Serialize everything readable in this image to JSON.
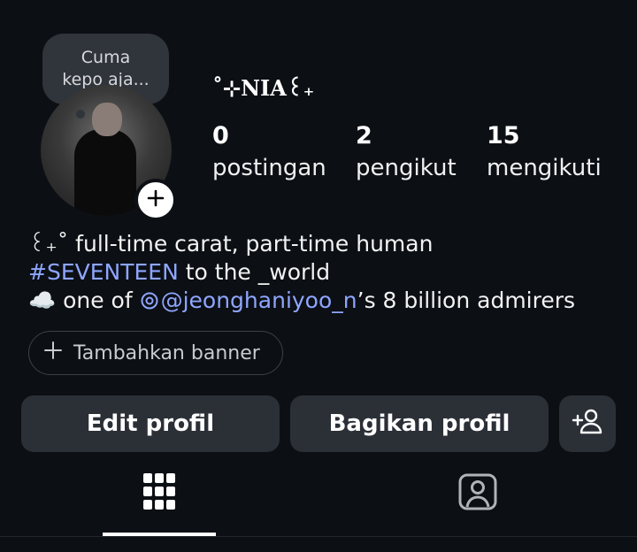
{
  "note": {
    "text_line1": "Cuma",
    "text_line2": "kepo aja..."
  },
  "profile": {
    "display_name": "˚⊹NIA꒰₊",
    "stats": [
      {
        "value": "0",
        "label": "postingan"
      },
      {
        "value": "2",
        "label": "pengikut"
      },
      {
        "value": "15",
        "label": "mengikuti"
      }
    ],
    "bio": {
      "line1": "꒰₊˚ full-time carat, part-time human",
      "line2_hashtag": "#SEVENTEEN",
      "line2_rest": " to the _world",
      "line3_prefix": "☁️ one of ",
      "line3_mention": "@jeonghaniyoo_n",
      "line3_rest": "’s 8 billion admirers"
    }
  },
  "actions": {
    "add_banner": "Tambahkan banner",
    "edit_profile": "Edit profil",
    "share_profile": "Bagikan profil"
  },
  "tabs": [
    {
      "name": "grid",
      "icon": "grid-icon",
      "active": true
    },
    {
      "name": "tagged",
      "icon": "tagged-person-icon",
      "active": false
    }
  ],
  "colors": {
    "background": "#0c0f14",
    "button": "#2b2f36",
    "link": "#8ea6ff"
  }
}
